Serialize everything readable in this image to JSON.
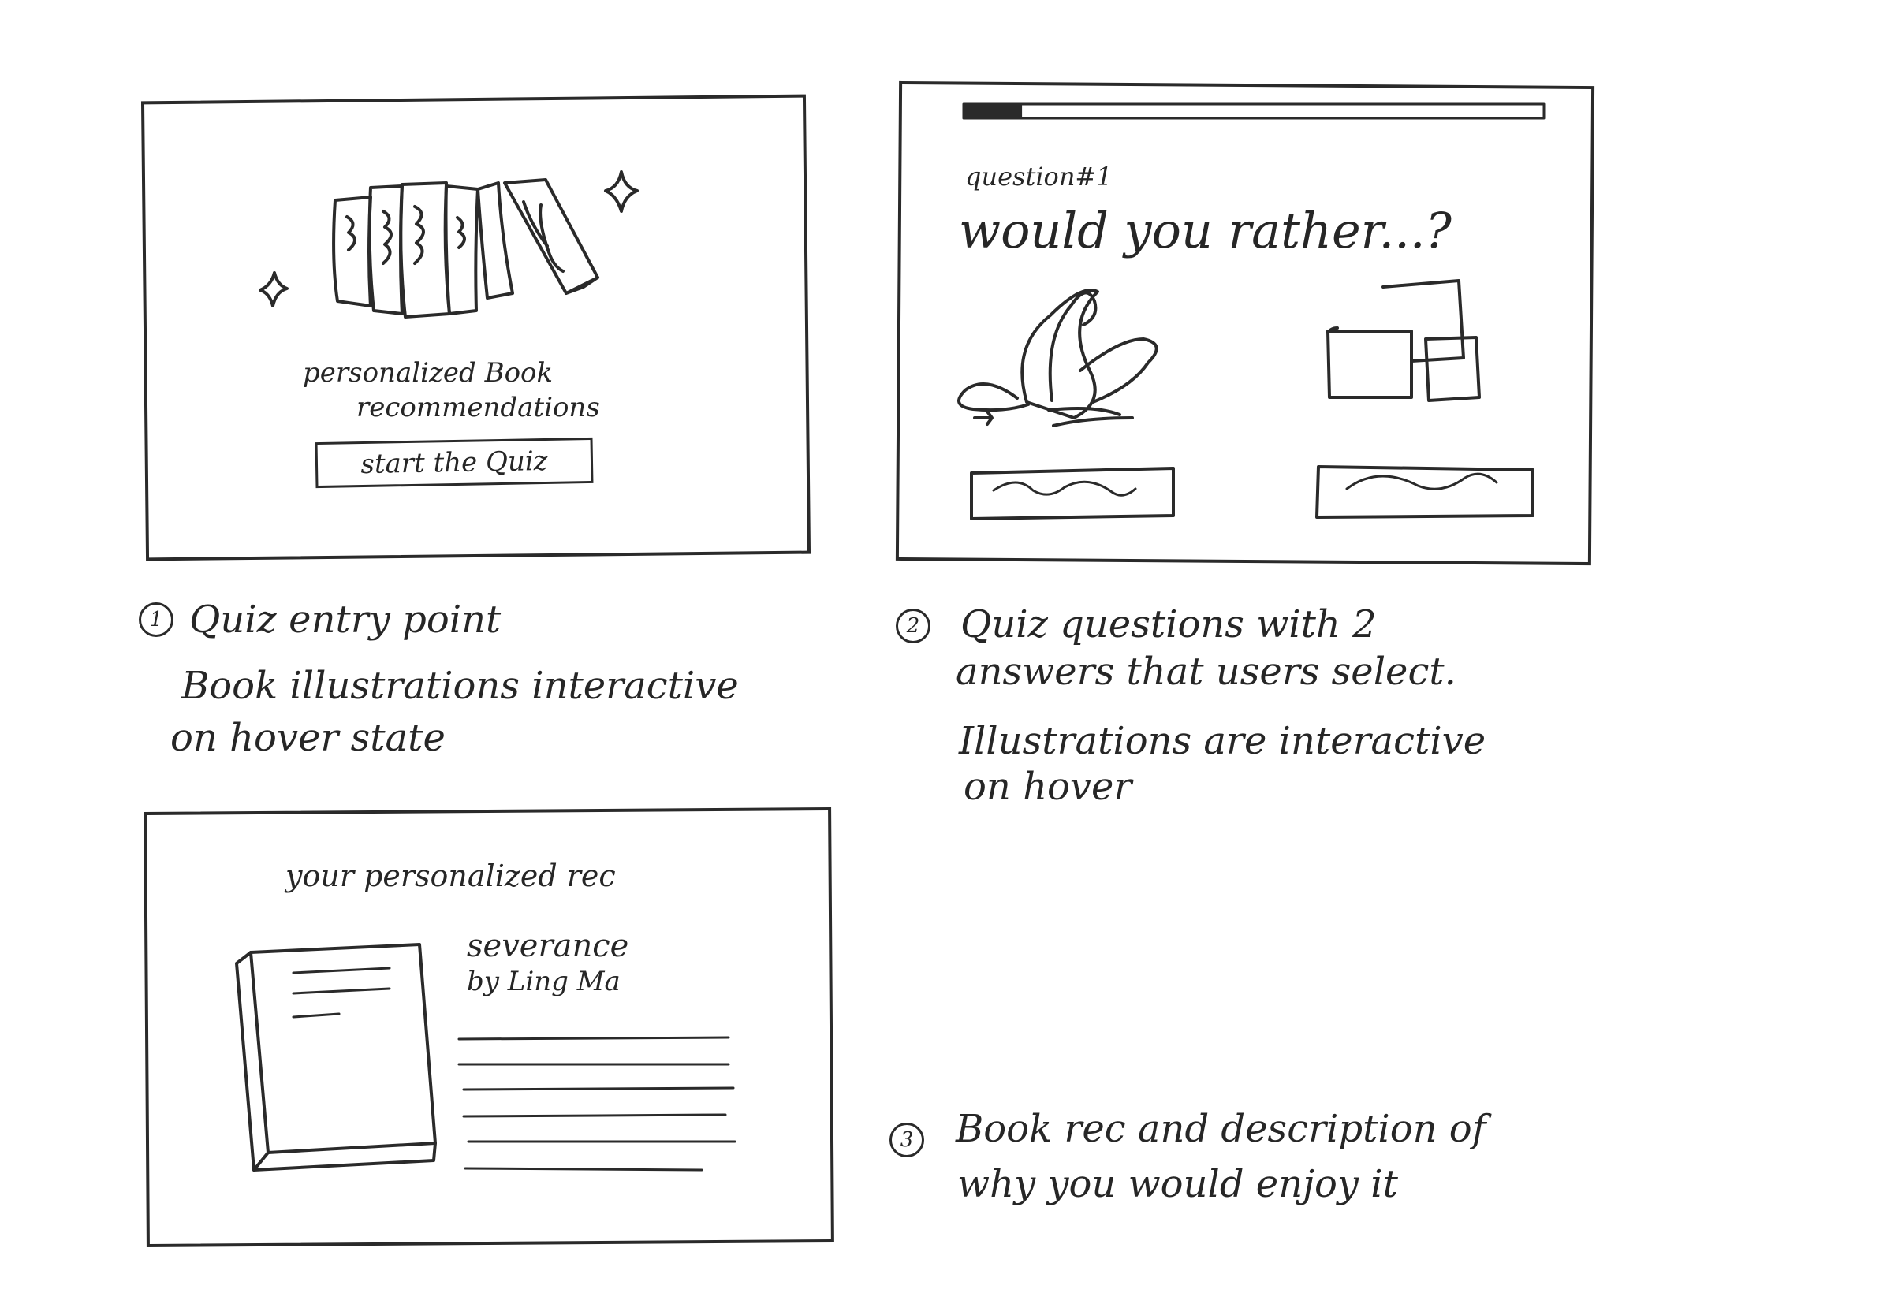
{
  "frames": {
    "entry": {
      "title_line1": "personalized Book",
      "title_line2": "recommendations",
      "start_button": "start the Quiz"
    },
    "question": {
      "question_number": "question#1",
      "question_text": "would you rather...?",
      "progress": 0.1
    },
    "result": {
      "heading": "your personalized rec",
      "book_title": "severance",
      "book_author": "by Ling Ma"
    }
  },
  "notes": {
    "note1": {
      "number": "1",
      "line1": "Quiz entry point",
      "line2": "Book illustrations interactive",
      "line3": "on hover state"
    },
    "note2": {
      "number": "2",
      "line1": "Quiz questions with 2",
      "line2": "answers that users select.",
      "line3": "Illustrations are interactive",
      "line4": "on hover"
    },
    "note3": {
      "number": "3",
      "line1": "Book rec and description of",
      "line2": "why you would enjoy it"
    }
  }
}
